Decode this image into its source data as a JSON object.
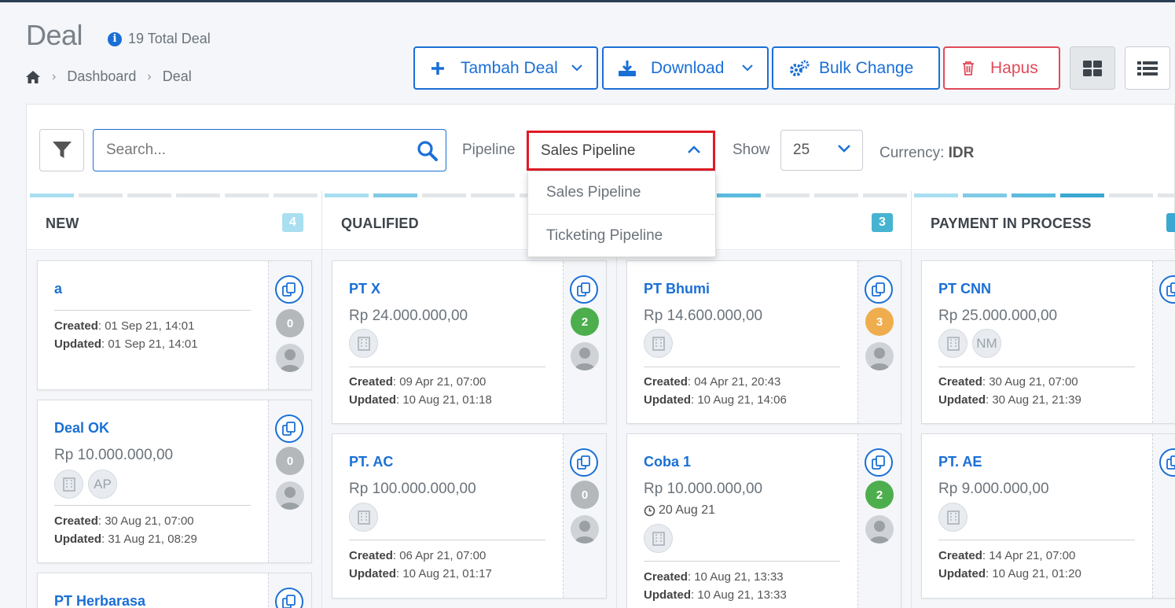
{
  "header": {
    "title": "Deal",
    "total": "19 Total Deal",
    "breadcrumb": [
      "Dashboard",
      "Deal"
    ]
  },
  "toolbar": {
    "add_label": "Tambah Deal",
    "download_label": "Download",
    "bulk_label": "Bulk Change",
    "delete_label": "Hapus"
  },
  "filters": {
    "search_placeholder": "Search...",
    "pipeline_label": "Pipeline",
    "pipeline_value": "Sales Pipeline",
    "pipeline_options": [
      "Sales Pipeline",
      "Ticketing Pipeline"
    ],
    "show_label": "Show",
    "show_value": "25",
    "currency_label": "Currency:",
    "currency_value": "IDR"
  },
  "columns": [
    {
      "title": "NEW",
      "count": "4",
      "count_color": "#a9dff0",
      "cards": [
        {
          "name": "a",
          "amount": "",
          "chips": [],
          "created": "01 Sep 21, 14:01",
          "updated": "01 Sep 21, 14:01",
          "count": "0",
          "count_color": "#b5b8bb"
        },
        {
          "name": "Deal OK",
          "amount": "Rp 10.000.000,00",
          "chips": [
            "",
            "AP"
          ],
          "created": "30 Aug 21, 07:00",
          "updated": "31 Aug 21, 08:29",
          "count": "0",
          "count_color": "#b5b8bb"
        },
        {
          "name": "PT Herbarasa",
          "amount": "",
          "chips": [],
          "created": "",
          "updated": "",
          "count": "",
          "count_color": ""
        }
      ]
    },
    {
      "title": "QUALIFIED",
      "count": "",
      "cards": [
        {
          "name": "PT X",
          "amount": "Rp 24.000.000,00",
          "chips": [
            ""
          ],
          "created": "09 Apr 21, 07:00",
          "updated": "10 Aug 21, 01:18",
          "count": "2",
          "count_color": "#4cae4c"
        },
        {
          "name": "PT. AC",
          "amount": "Rp 100.000.000,00",
          "chips": [
            ""
          ],
          "created": "06 Apr 21, 07:00",
          "updated": "10 Aug 21, 01:17",
          "count": "0",
          "count_color": "#b5b8bb"
        }
      ]
    },
    {
      "title": "",
      "count": "3",
      "count_color": "#46b4d0",
      "cards": [
        {
          "name": "PT Bhumi",
          "amount": "Rp 14.600.000,00",
          "chips": [
            ""
          ],
          "created": "04 Apr 21, 20:43",
          "updated": "10 Aug 21, 14:06",
          "count": "3",
          "count_color": "#f0ad4e"
        },
        {
          "name": "Coba 1",
          "amount": "Rp 10.000.000,00",
          "due": "20 Aug 21",
          "chips": [
            ""
          ],
          "created": "10 Aug 21, 13:33",
          "updated": "10 Aug 21, 13:33",
          "count": "2",
          "count_color": "#4cae4c"
        }
      ]
    },
    {
      "title": "PAYMENT IN PROCESS",
      "count": "",
      "cards": [
        {
          "name": "PT CNN",
          "amount": "Rp 25.000.000,00",
          "chips": [
            "",
            "NM"
          ],
          "created": "30 Aug 21, 07:00",
          "updated": "30 Aug 21, 21:39"
        },
        {
          "name": "PT. AE",
          "amount": "Rp 9.000.000,00",
          "chips": [
            ""
          ],
          "created": "14 Apr 21, 07:00",
          "updated": "10 Aug 21, 01:20"
        }
      ]
    }
  ],
  "labels": {
    "created": "Created",
    "updated": "Updated"
  }
}
